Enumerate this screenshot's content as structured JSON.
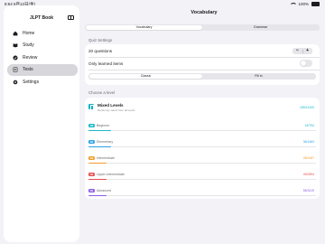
{
  "statusbar": {
    "time": "8:54",
    "date": "6月12日(金)",
    "battery_text": "100%"
  },
  "sidebar": {
    "title": "JLPT Book",
    "items": [
      {
        "label": "Home",
        "icon": "house-icon",
        "active": false
      },
      {
        "label": "Study",
        "icon": "book-icon",
        "active": false
      },
      {
        "label": "Review",
        "icon": "review-icon",
        "active": false
      },
      {
        "label": "Tests",
        "icon": "test-icon",
        "active": true
      },
      {
        "label": "Settings",
        "icon": "gear-icon",
        "active": false
      }
    ]
  },
  "main": {
    "title": "Vocabulary",
    "top_tabs": [
      {
        "label": "Vocabulary",
        "selected": true
      },
      {
        "label": "Grammar",
        "selected": false
      }
    ],
    "quiz_settings": {
      "header": "Quiz Settings",
      "question_count": "20 questions",
      "minus": "−",
      "plus": "+",
      "only_learned_label": "Only learned items",
      "only_learned_on": false,
      "modes": [
        {
          "label": "Classic",
          "selected": true
        },
        {
          "label": "Fill in",
          "selected": false
        }
      ]
    },
    "choose_level": {
      "header": "Choose a level",
      "mixed": {
        "name": "Mixed Levels",
        "subtitle": "Randomly select from all levels",
        "ratio": "189/13100"
      },
      "levels": [
        {
          "badge": "N5",
          "name": "Beginner",
          "ratio": "15/794",
          "color": "#19b8c9",
          "progress": 0.1
        },
        {
          "badge": "N4",
          "name": "Elementary",
          "ratio": "36/1463",
          "color": "#2e9fe6",
          "progress": 0.1
        },
        {
          "badge": "N3",
          "name": "Intermediate",
          "ratio": "28/1487",
          "color": "#f29c2b",
          "progress": 0.08
        },
        {
          "badge": "N2",
          "name": "Upper-Intermediate",
          "ratio": "49/2594",
          "color": "#e84c4c",
          "progress": 0.08
        },
        {
          "badge": "N1",
          "name": "Advanced",
          "ratio": "55/3419",
          "color": "#8c5ce6",
          "progress": 0.08
        }
      ]
    }
  }
}
